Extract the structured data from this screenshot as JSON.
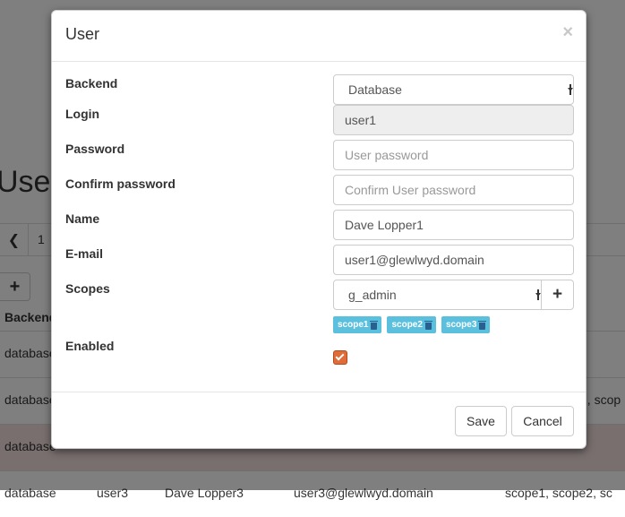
{
  "background": {
    "page_title": "User",
    "pager_number": "1",
    "add_symbol": "+",
    "table_header": "Backend",
    "rows": [
      {
        "backend": "database",
        "extra": ""
      },
      {
        "backend": "database",
        "extra": "2, scop"
      },
      {
        "backend": "database",
        "extra": ""
      },
      {
        "backend": "database",
        "user": "user3",
        "name": "Dave Lopper3",
        "email": "user3@glewlwyd.domain",
        "scopes": "scope1, scope2, sc"
      }
    ]
  },
  "modal": {
    "title": "User",
    "close_symbol": "×",
    "fields": {
      "backend": {
        "label": "Backend",
        "value": "Database"
      },
      "login": {
        "label": "Login",
        "value": "user1"
      },
      "password": {
        "label": "Password",
        "placeholder": "User password"
      },
      "confirm_password": {
        "label": "Confirm password",
        "placeholder": "Confirm User password"
      },
      "name": {
        "label": "Name",
        "value": "Dave Lopper1"
      },
      "email": {
        "label": "E-mail",
        "value": "user1@glewlwyd.domain"
      },
      "scopes": {
        "label": "Scopes",
        "selected": "g_admin",
        "add_symbol": "+",
        "tags": [
          "scope1",
          "scope2",
          "scope3"
        ]
      },
      "enabled": {
        "label": "Enabled",
        "checked": true
      }
    },
    "footer": {
      "save_label": "Save",
      "cancel_label": "Cancel"
    }
  },
  "colors": {
    "badge": "#5bc0de",
    "checkbox_accent": "#e06c3a",
    "disabled_row": "#f2dede"
  }
}
